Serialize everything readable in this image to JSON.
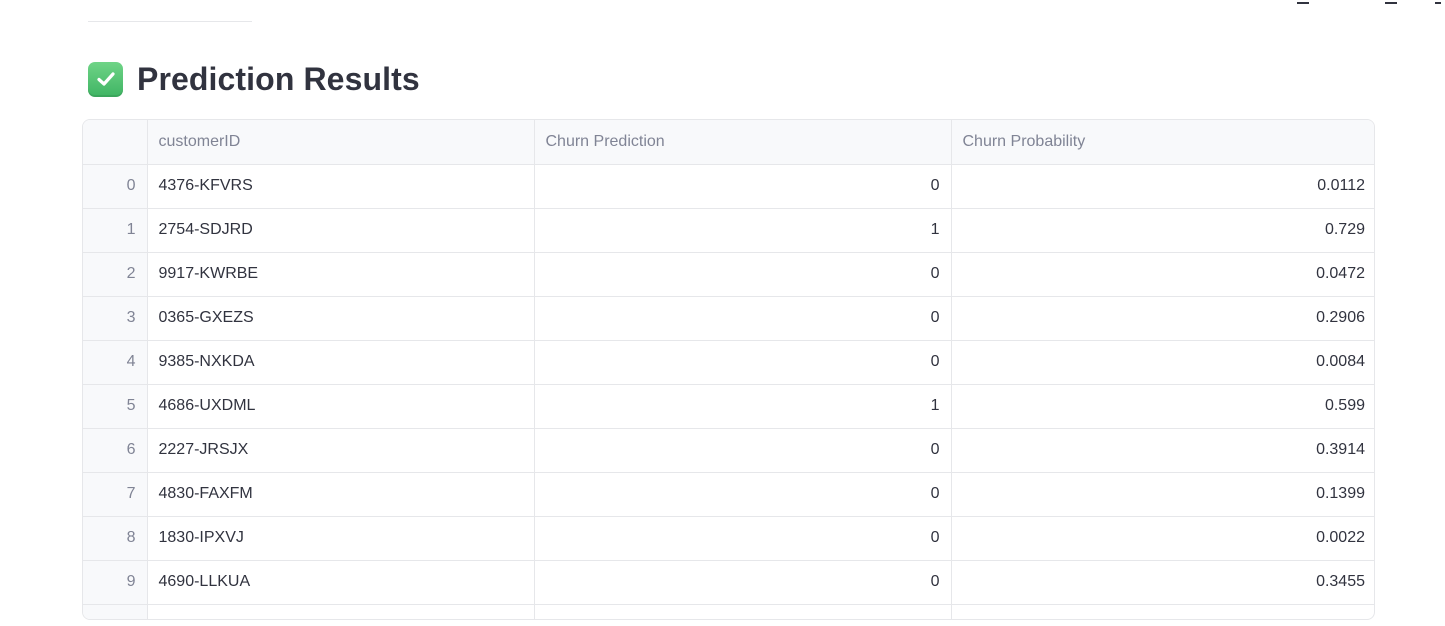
{
  "title": "Prediction Results",
  "icon": "check-mark-button-icon",
  "table": {
    "columns": [
      "customerID",
      "Churn Prediction",
      "Churn Probability"
    ],
    "rows": [
      {
        "index": "0",
        "customerID": "4376-KFVRS",
        "churn_prediction": "0",
        "churn_probability": "0.0112"
      },
      {
        "index": "1",
        "customerID": "2754-SDJRD",
        "churn_prediction": "1",
        "churn_probability": "0.729"
      },
      {
        "index": "2",
        "customerID": "9917-KWRBE",
        "churn_prediction": "0",
        "churn_probability": "0.0472"
      },
      {
        "index": "3",
        "customerID": "0365-GXEZS",
        "churn_prediction": "0",
        "churn_probability": "0.2906"
      },
      {
        "index": "4",
        "customerID": "9385-NXKDA",
        "churn_prediction": "0",
        "churn_probability": "0.0084"
      },
      {
        "index": "5",
        "customerID": "4686-UXDML",
        "churn_prediction": "1",
        "churn_probability": "0.599"
      },
      {
        "index": "6",
        "customerID": "2227-JRSJX",
        "churn_prediction": "0",
        "churn_probability": "0.3914"
      },
      {
        "index": "7",
        "customerID": "4830-FAXFM",
        "churn_prediction": "0",
        "churn_probability": "0.1399"
      },
      {
        "index": "8",
        "customerID": "1830-IPXVJ",
        "churn_prediction": "0",
        "churn_probability": "0.0022"
      },
      {
        "index": "9",
        "customerID": "4690-LLKUA",
        "churn_prediction": "0",
        "churn_probability": "0.3455"
      }
    ]
  },
  "colors": {
    "accent_check": "#3fb463",
    "header_bg": "#f8f9fb",
    "border": "#e6e7ea",
    "text": "#31333f",
    "muted_text": "#808495"
  }
}
